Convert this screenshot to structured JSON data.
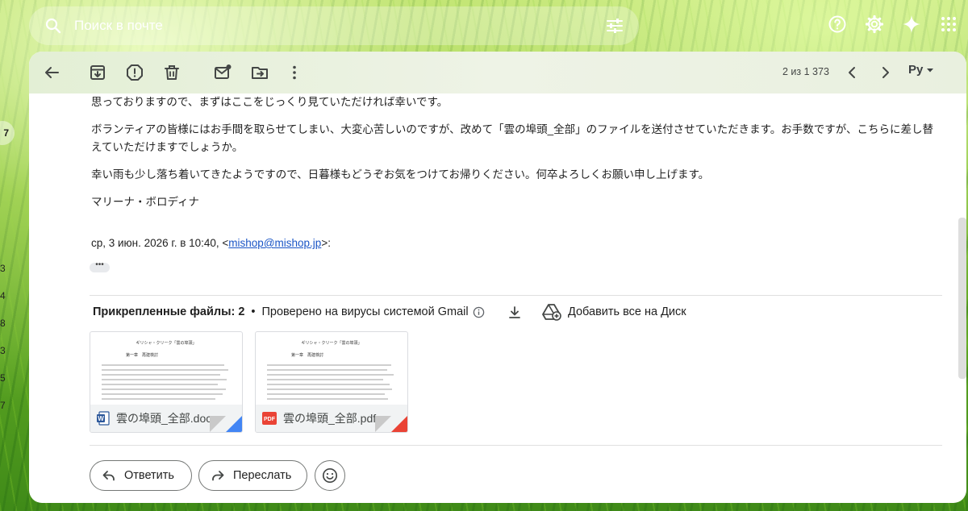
{
  "search": {
    "placeholder": "Поиск в почте"
  },
  "top_actions": [
    "help-icon",
    "settings-icon",
    "gemini-icon",
    "apps-grid-icon"
  ],
  "left_edge": {
    "badge": "7",
    "numbers": [
      "3",
      "4",
      "8",
      "3",
      "5",
      "7"
    ]
  },
  "toolbar": {
    "buttons": [
      "back-arrow-icon",
      "archive-icon",
      "report-spam-icon",
      "delete-icon",
      "mark-unread-icon",
      "move-to-icon",
      "more-vert-icon"
    ],
    "pager": "2 из 1 373",
    "lang": "Ру"
  },
  "message": {
    "p1": "思っておりますので、まずはここをじっくり見ていただければ幸いです。",
    "p2": "ボランティアの皆様にはお手間を取らせてしまい、大変心苦しいのですが、改めて「雲の埠頭_全部」のファイルを送付させていただきます。お手数ですが、こちらに差し替えていただけますでしょうか。",
    "p3": "幸い雨も少し落ち着いてきたようですので、日暮様もどうぞお気をつけてお帰りください。何卒よろしくお願い申し上げます。",
    "p4": "マリーナ・ボロディナ",
    "quote_prefix": "ср, 3 июн. 2026 г. в 10:40, <",
    "quote_email": "mishop@mishop.jp",
    "quote_suffix": ">:",
    "ellipsis": "•••"
  },
  "attachments": {
    "header_count": "Прикрепленные файлы: 2",
    "dot": "•",
    "scan_note": "Проверено на вирусы системой Gmail",
    "add_to_drive": "Добавить все на Диск",
    "files": [
      {
        "name": "雲の埠頭_全部.docx",
        "type": "docx",
        "preview_title": "ギリシャ・クリーク「雲の埠頭」",
        "preview_heading": "第一章　再建検討",
        "accent": "#4285f4"
      },
      {
        "name": "雲の埠頭_全部.pdf",
        "type": "pdf",
        "preview_title": "ギリシャ・クリーク「雲の埠頭」",
        "preview_heading": "第一章　再建検討",
        "accent": "#ea4335"
      }
    ]
  },
  "actions": {
    "reply": "Ответить",
    "forward": "Переслать"
  },
  "colors": {
    "link": "#1a55c6",
    "toolbar_bg": "#e3efd5",
    "doc_blue": "#2b579a",
    "pdf_red": "#ea4335"
  }
}
